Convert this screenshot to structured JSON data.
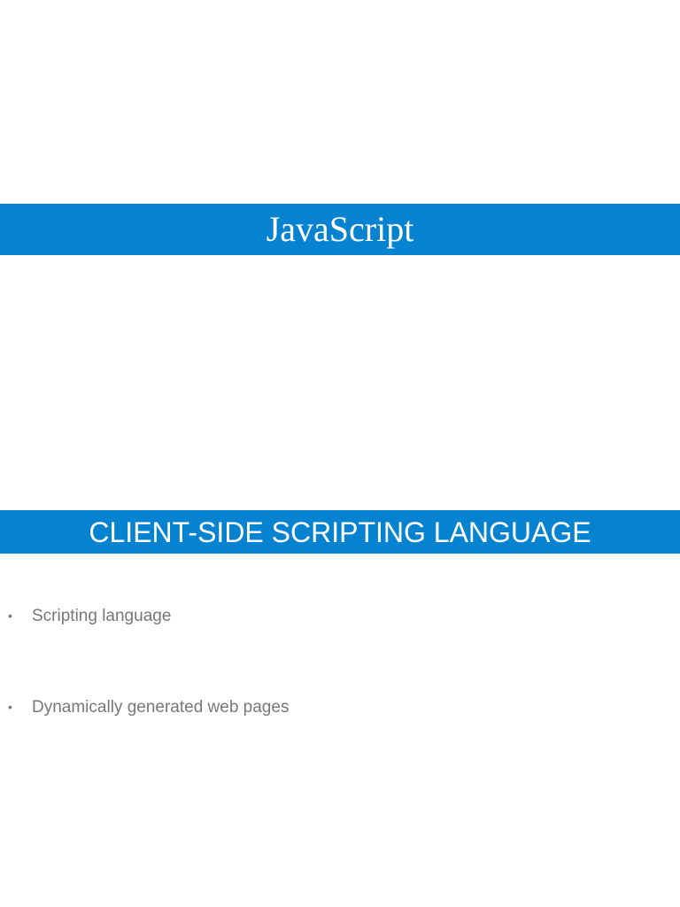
{
  "slide1": {
    "title": "JavaScript"
  },
  "slide2": {
    "title": "CLIENT-SIDE SCRIPTING LANGUAGE",
    "bullets": [
      "Scripting language",
      "Dynamically generated web pages"
    ]
  },
  "colors": {
    "accent": "#0683d0",
    "bullet_text": "#777777"
  }
}
